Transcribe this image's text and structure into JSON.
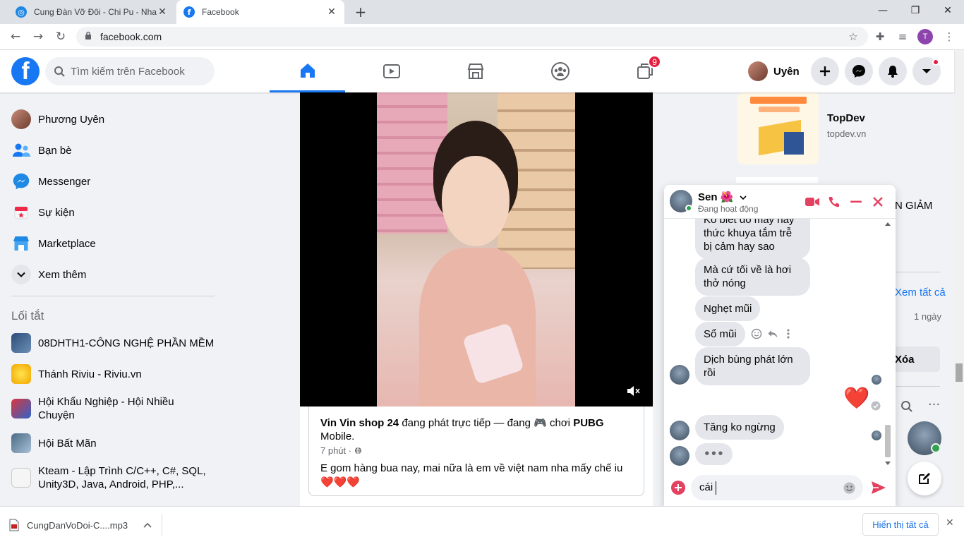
{
  "browser": {
    "tabs": [
      {
        "title": "Cung Đàn Vỡ Đôi - Chi Pu - Nhac",
        "active": false
      },
      {
        "title": "Facebook",
        "active": true
      }
    ],
    "new_tab": "+",
    "url": "facebook.com",
    "profile_initial": "T",
    "window_controls": [
      "minimize",
      "maximize",
      "close"
    ]
  },
  "fb_header": {
    "logo": "f",
    "search_placeholder": "Tìm kiếm trên Facebook",
    "nav_tabs": [
      "home-icon",
      "watch-icon",
      "marketplace-icon",
      "groups-icon",
      "gaming-icon"
    ],
    "gaming_badge": "9",
    "user_name": "Uyên"
  },
  "left_sidebar": {
    "items": [
      {
        "label": "Phương Uyên",
        "icon": "avatar"
      },
      {
        "label": "Bạn bè",
        "icon": "friends-icon"
      },
      {
        "label": "Messenger",
        "icon": "messenger-icon"
      },
      {
        "label": "Sự kiện",
        "icon": "events-icon"
      },
      {
        "label": "Marketplace",
        "icon": "marketplace-icon"
      },
      {
        "label": "Xem thêm",
        "icon": "chevron-down-icon"
      }
    ],
    "shortcuts_title": "Lối tắt",
    "shortcuts": [
      {
        "label": "08DHTH1-CÔNG NGHỆ PHẦN MỀM"
      },
      {
        "label": "Thánh Riviu - Riviu.vn"
      },
      {
        "label": "Hội Khẩu Nghiệp - Hội Nhiều Chuyện"
      },
      {
        "label": "Hội Bất Mãn"
      },
      {
        "label": "Kteam - Lập Trình C/C++, C#, SQL, Unity3D, Java, Android, PHP,..."
      }
    ]
  },
  "post": {
    "shared_author": "Vin Vin shop 24",
    "shared_action": " đang phát trực tiếp — đang 🎮  chơi ",
    "shared_game": "PUBG",
    "shared_game_tail": "Mobile.",
    "time": "7 phút ·",
    "caption": "E gom hàng bua nay, mai nữa là em về việt nam nha mấy chế iu",
    "caption_hearts": "❤️❤️❤️"
  },
  "right_col": {
    "ad_title": "TopDev",
    "ad_url": "topdev.vn",
    "partial_text_1": "N GIẢM",
    "partial_text_2": "Xem tất cả",
    "partial_text_3": "1 ngày",
    "partial_text_4": "Xóa"
  },
  "chat": {
    "name": "Sen 🌺",
    "status": "Đang hoạt động",
    "messages": [
      "Ko biết do máy hay thức khuya tắm trễ bị cảm hay sao",
      "Mà cứ tối về là hơi thở nóng",
      "Nghẹt mũi",
      "Sổ mũi",
      "Dịch bùng phát lớn rồi",
      "Tăng ko ngừng",
      "•••"
    ],
    "sent_emoji": "❤️",
    "input_value": "cái"
  },
  "download_bar": {
    "file_name": "CungDanVoDoi-C....mp3",
    "show_all": "Hiển thị tất cả"
  },
  "colors": {
    "fb_blue": "#1877f2",
    "messenger_pink": "#e4405f",
    "badge_red": "#e41e3f"
  }
}
